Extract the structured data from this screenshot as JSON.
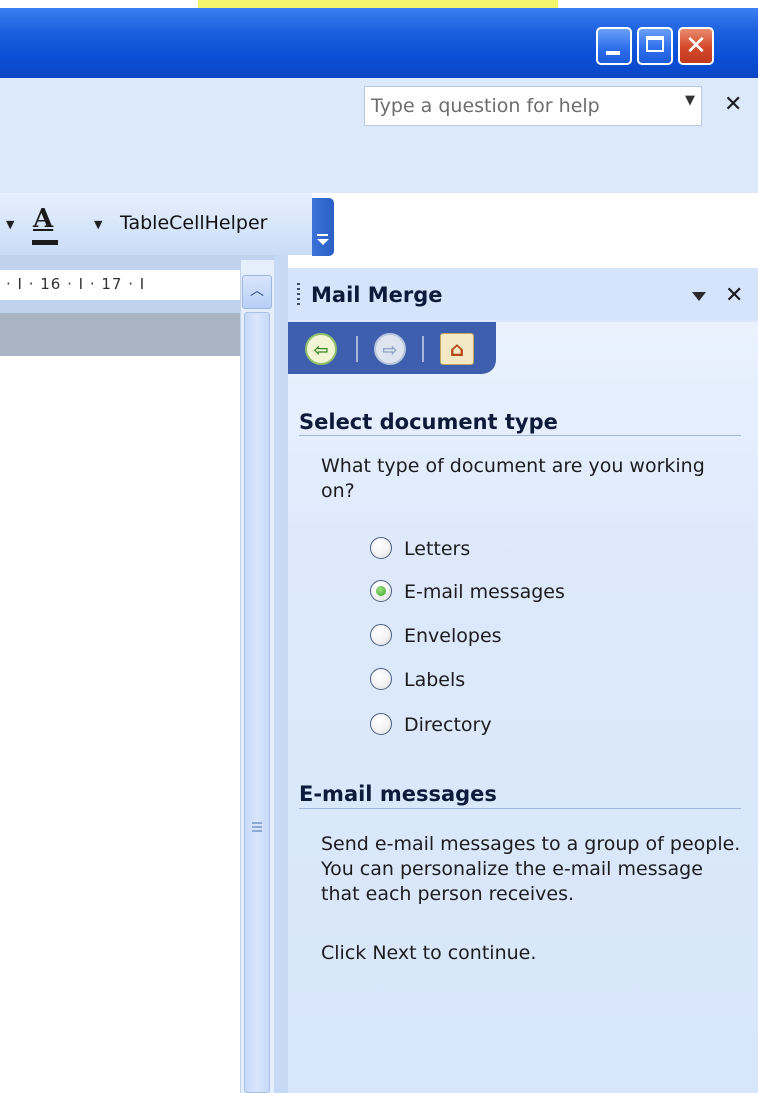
{
  "window": {
    "minimize_icon": "minimize-icon",
    "maximize_icon": "maximize-icon",
    "close_glyph": "✕"
  },
  "help": {
    "placeholder": "Type a question for help",
    "dropdown_glyph": "▼",
    "close_glyph": "✕"
  },
  "toolbar": {
    "font_color_glyph": "A",
    "dropdown_glyph": "▼",
    "custom_button_label": "TableCellHelper",
    "options_icon": "toolbar-options-icon"
  },
  "ruler": {
    "text": "·  I  · 16 ·  I  · 17 ·  I"
  },
  "scrollbar": {
    "up_glyph": "︿"
  },
  "task_pane": {
    "title": "Mail Merge",
    "menu_icon": "dropdown-arrow-icon",
    "close_glyph": "✕",
    "nav": {
      "back_glyph": "⇦",
      "forward_glyph": "⇨",
      "home_glyph": "⌂"
    },
    "section1": {
      "title": "Select document type",
      "question": "What type of document are you working on?",
      "options": [
        {
          "label": "Letters",
          "checked": false
        },
        {
          "label": "E-mail messages",
          "checked": true
        },
        {
          "label": "Envelopes",
          "checked": false
        },
        {
          "label": "Labels",
          "checked": false
        },
        {
          "label": "Directory",
          "checked": false
        }
      ]
    },
    "section2": {
      "title": "E-mail messages",
      "description": "Send e-mail messages to a group of people. You can personalize the e-mail message that each person receives.",
      "continue_text": "Click Next to continue."
    }
  },
  "colors": {
    "titlebar": "#0a4fd8",
    "pane_bg": "#dde9fb",
    "nav_tab": "#3d5fae",
    "checked_radio": "#37a51c"
  }
}
